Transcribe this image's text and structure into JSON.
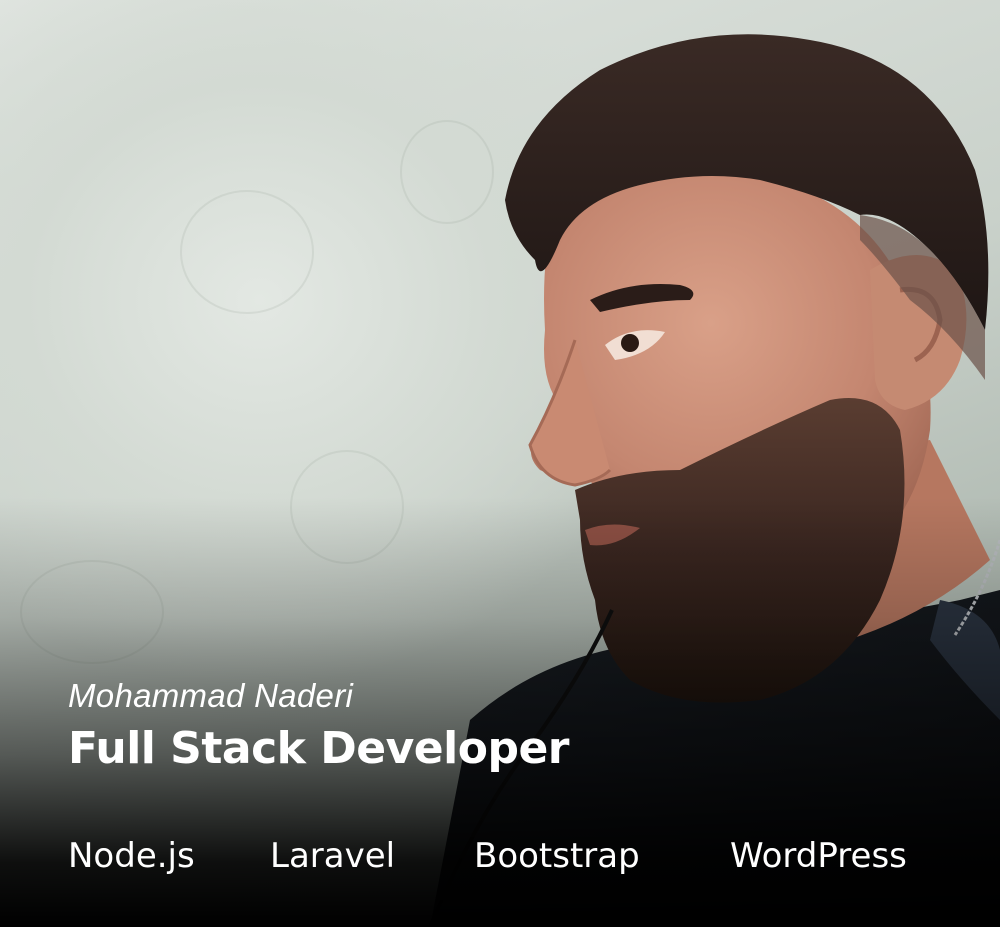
{
  "profile": {
    "name": "Mohammad Naderi",
    "role": "Full Stack Developer",
    "skills": [
      "Node.js",
      "Laravel",
      "Bootstrap",
      "WordPress"
    ]
  },
  "photo": {
    "icon": "portrait-photo",
    "colors": {
      "wall": "#d3dad3",
      "hair": "#2a1f1c",
      "skin": "#c98d74",
      "beard": "#3b2a24",
      "shirt": "#14181c",
      "text": "#ffffff"
    }
  }
}
